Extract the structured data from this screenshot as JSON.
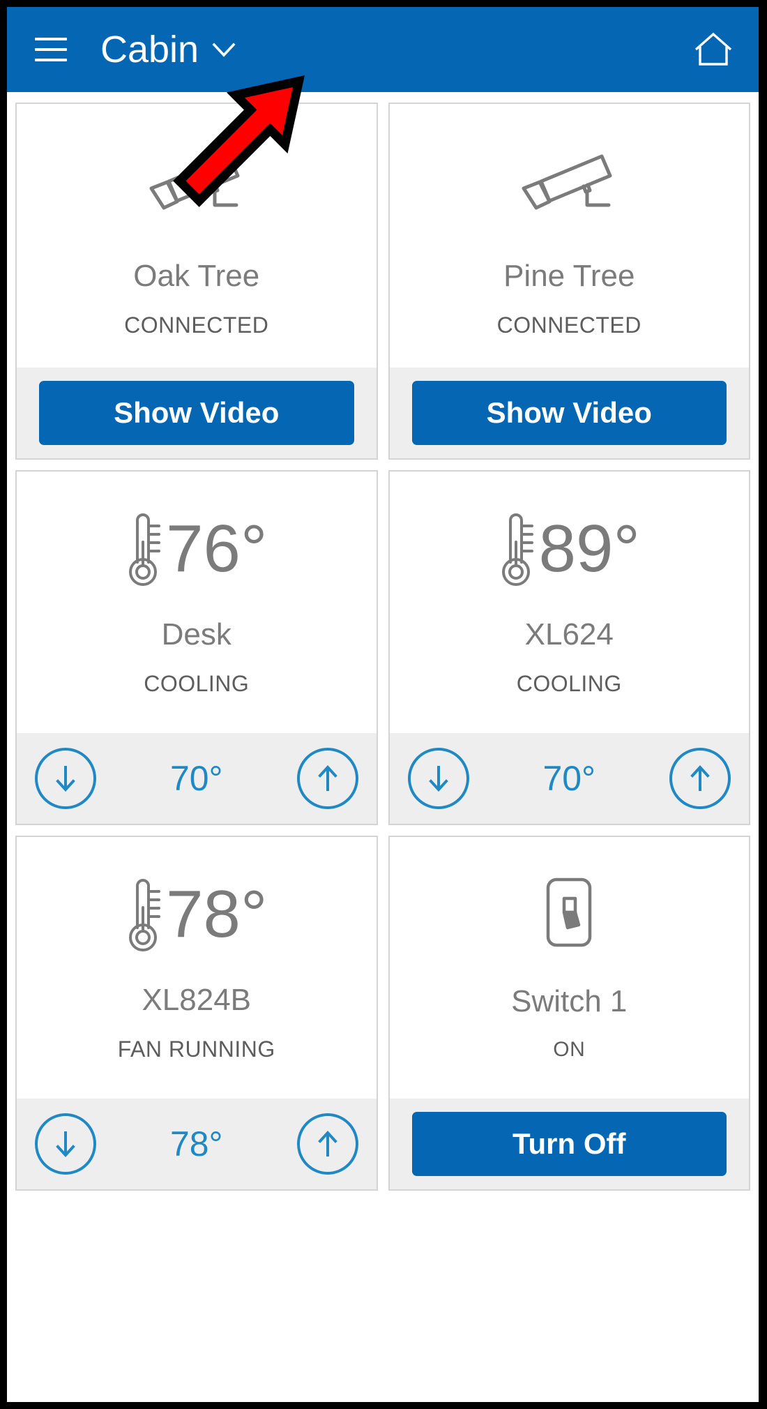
{
  "appbar": {
    "menu_icon": "hamburger-menu-icon",
    "title": "Cabin",
    "dropdown_icon": "chevron-down-icon",
    "home_icon": "home-icon",
    "background_color": "#0567b3"
  },
  "annotation": {
    "type": "arrow",
    "color": "#ff0000",
    "outline_color": "#000000",
    "points_to": "Cabin"
  },
  "cards": [
    {
      "type": "camera",
      "icon": "security-camera-icon",
      "name": "Oak Tree",
      "status": "CONNECTED",
      "action_label": "Show Video"
    },
    {
      "type": "camera",
      "icon": "security-camera-icon",
      "name": "Pine Tree",
      "status": "CONNECTED",
      "action_label": "Show Video"
    },
    {
      "type": "thermostat",
      "icon": "thermometer-icon",
      "temperature": "76°",
      "name": "Desk",
      "status": "COOLING",
      "setpoint": "70°",
      "decrease_icon": "arrow-down-icon",
      "increase_icon": "arrow-up-icon"
    },
    {
      "type": "thermostat",
      "icon": "thermometer-icon",
      "temperature": "89°",
      "name": "XL624",
      "status": "COOLING",
      "setpoint": "70°",
      "decrease_icon": "arrow-down-icon",
      "increase_icon": "arrow-up-icon"
    },
    {
      "type": "thermostat",
      "icon": "thermometer-icon",
      "temperature": "78°",
      "name": "XL824B",
      "status": "FAN RUNNING",
      "setpoint": "78°",
      "decrease_icon": "arrow-down-icon",
      "increase_icon": "arrow-up-icon"
    },
    {
      "type": "switch",
      "icon": "light-switch-icon",
      "name": "Switch 1",
      "status": "ON",
      "action_label": "Turn Off"
    }
  ],
  "colors": {
    "accent_blue": "#0567b3",
    "control_blue": "#2089c4",
    "text_gray": "#7b7b7b",
    "status_gray": "#5d5d5d",
    "footer_gray": "#eeeeee",
    "card_border": "#d4d4d4"
  }
}
